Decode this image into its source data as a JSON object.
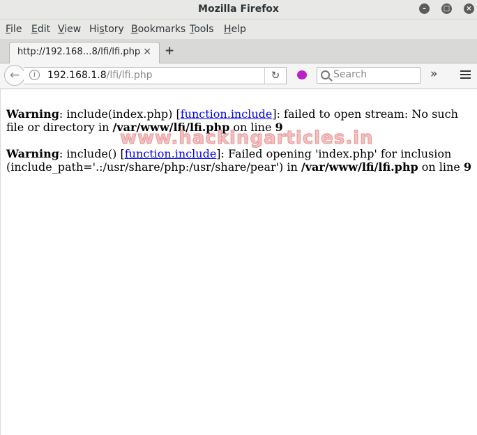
{
  "window": {
    "title": "Mozilla Firefox",
    "controls": [
      "minimize",
      "maximize",
      "close"
    ]
  },
  "menu": {
    "items": [
      {
        "label": "File",
        "mnemonic": "F",
        "rest": "ile"
      },
      {
        "label": "Edit",
        "mnemonic": "E",
        "rest": "dit"
      },
      {
        "label": "View",
        "mnemonic": "V",
        "rest": "iew"
      },
      {
        "label": "History",
        "pre": "Hi",
        "mnemonic": "s",
        "rest": "tory"
      },
      {
        "label": "Bookmarks",
        "mnemonic": "B",
        "rest": "ookmarks"
      },
      {
        "label": "Tools",
        "mnemonic": "T",
        "rest": "ools"
      },
      {
        "label": "Help",
        "mnemonic": "H",
        "rest": "elp"
      }
    ]
  },
  "tab": {
    "title": "http://192.168…8/lfi/lfi.php",
    "close": "×",
    "new_tab": "+"
  },
  "navbar": {
    "back": "←",
    "url_host": "192.168.1.8",
    "url_path": "/lfi/lfi.php",
    "reload": "↻",
    "search_placeholder": "Search",
    "overflow": "»"
  },
  "content": {
    "warning1": {
      "label": "Warning",
      "text1": ": include(index.php) [",
      "link": "function.include",
      "text2": "]: failed to open stream: No such file or directory in ",
      "path": "/var/www/lfi/lfi.php",
      "text3": " on line ",
      "line": "9"
    },
    "warning2": {
      "label": "Warning",
      "text1": ": include() [",
      "link": "function.include",
      "text2": "]: Failed opening 'index.php' for inclusion (include_path='.:/usr/share/php:/usr/share/pear') in ",
      "path": "/var/www/lfi/lfi.php",
      "text3": " on line ",
      "line": "9"
    },
    "watermark": "www.hackingarticles.in"
  },
  "colors": {
    "link": "#0000ee",
    "watermark": "#f4bcbc",
    "chrome": "#e8e8e7",
    "extension_icon": "#b820c8"
  }
}
